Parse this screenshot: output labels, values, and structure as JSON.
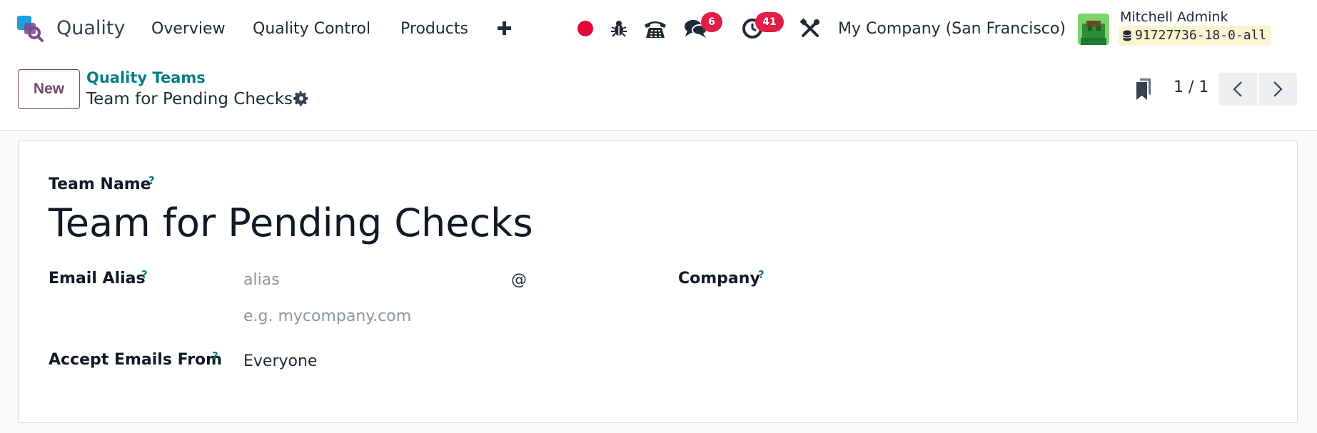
{
  "navbar": {
    "app_name": "Quality",
    "menu": [
      "Overview",
      "Quality Control",
      "Products"
    ],
    "messages_count": "6",
    "activities_count": "41",
    "company": "My Company (San Francisco)",
    "user_name": "Mitchell Admink",
    "database": "91727736-18-0-all"
  },
  "control_panel": {
    "new_label": "New",
    "breadcrumb_parent": "Quality Teams",
    "breadcrumb_current": "Team for Pending Checks",
    "pager": "1 / 1"
  },
  "form": {
    "team_name_label": "Team Name",
    "team_name_value": "Team for Pending Checks",
    "help_mark": "?",
    "email_alias_label": "Email Alias",
    "alias_placeholder": "alias",
    "at_sign": "@",
    "domain_placeholder": "e.g. mycompany.com",
    "company_label": "Company",
    "accept_emails_label": "Accept Emails From",
    "accept_emails_value": "Everyone"
  },
  "colors": {
    "brand": "#714b67",
    "link": "#017e84",
    "badge": "#e11d48",
    "recording_dot": "#e1063a"
  }
}
